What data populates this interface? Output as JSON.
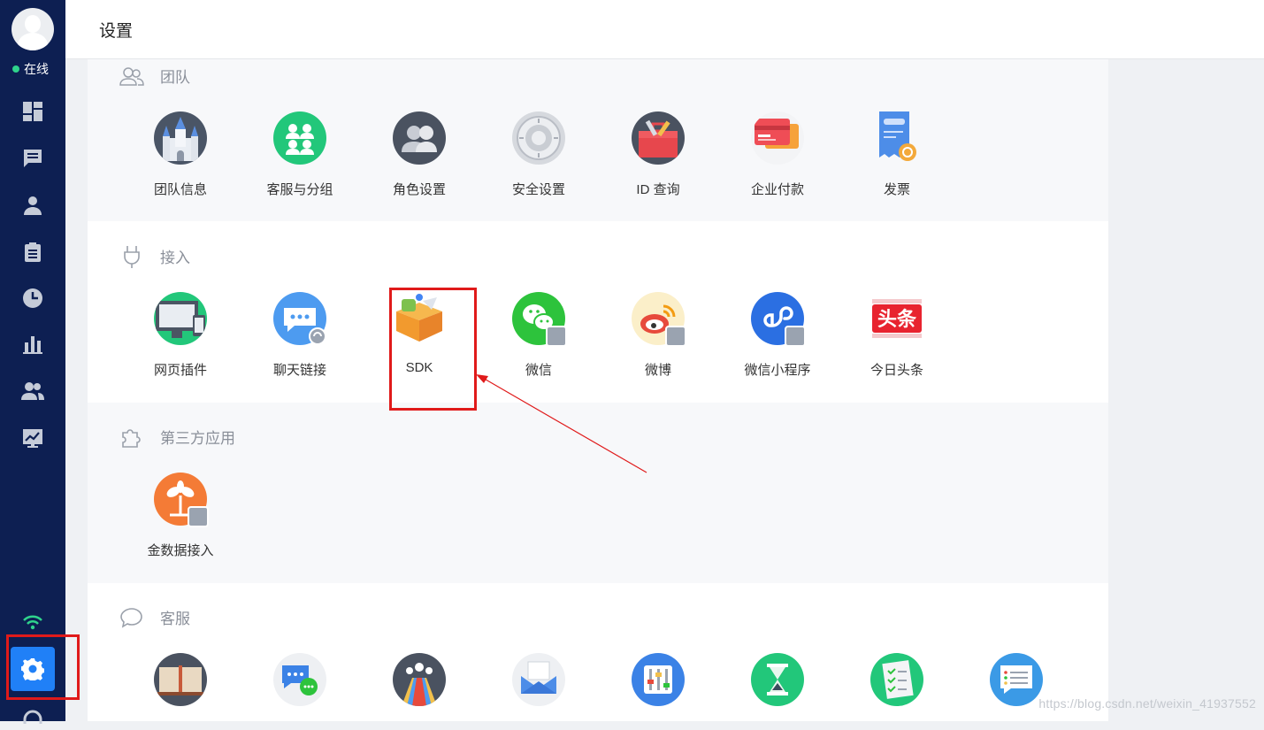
{
  "header": {
    "title": "设置"
  },
  "sidebar": {
    "status": "在线",
    "status_color": "#2fd38c",
    "nav_icons": [
      "dashboard-icon",
      "chat-icon",
      "user-icon",
      "clipboard-icon",
      "clock-icon",
      "bar-chart-icon",
      "team-icon",
      "trend-chart-icon"
    ],
    "bottom_icons": [
      "wifi-icon",
      "settings-icon",
      "headset-icon"
    ]
  },
  "sections": {
    "team": {
      "title": "团队",
      "items": [
        "团队信息",
        "客服与分组",
        "角色设置",
        "安全设置",
        "ID 查询",
        "企业付款",
        "发票"
      ]
    },
    "access": {
      "title": "接入",
      "items": [
        "网页插件",
        "聊天链接",
        "SDK",
        "微信",
        "微博",
        "微信小程序",
        "今日头条"
      ]
    },
    "third_party": {
      "title": "第三方应用",
      "items": [
        "金数据接入"
      ]
    },
    "service": {
      "title": "客服"
    }
  },
  "watermark": "https://blog.csdn.net/weixin_41937552",
  "colors": {
    "accent": "#2080f7",
    "sidebar": "#0d1f52",
    "highlight": "#e01a1a"
  }
}
